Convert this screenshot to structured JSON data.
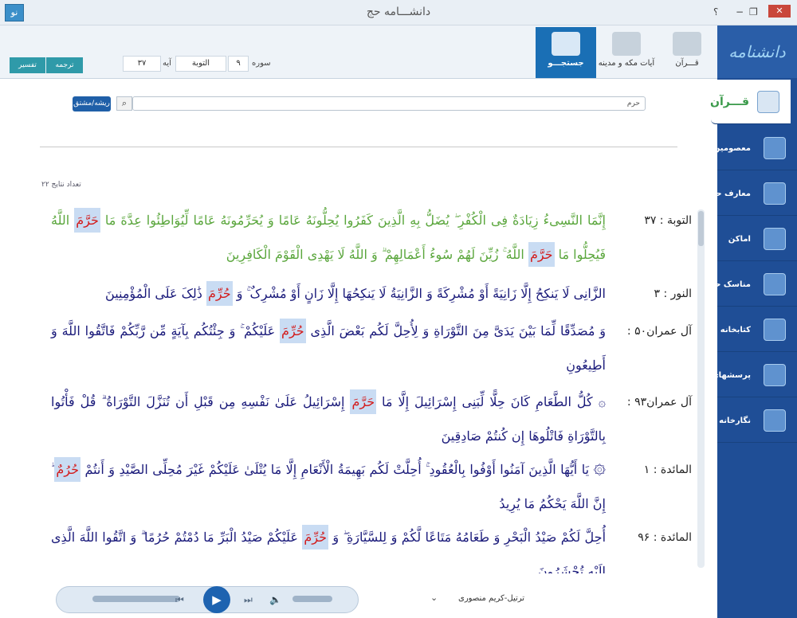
{
  "window": {
    "title": "دانشـــامه حج",
    "help": "؟",
    "restore": "❐",
    "minimize": "−",
    "close": "✕",
    "app_icon": "نو"
  },
  "sidebar": {
    "logo": "دانشنامه حج",
    "items": [
      {
        "label": "قـــرآن",
        "icon": "quran-stand-icon"
      },
      {
        "label": "معصومین",
        "icon": "shrine-icon"
      },
      {
        "label": "معارف حج",
        "icon": "book-icon"
      },
      {
        "label": "اماکن",
        "icon": "mosque-icon"
      },
      {
        "label": "مناسک حج",
        "icon": "pilgrim-icon"
      },
      {
        "label": "کتابخانه",
        "icon": "library-icon"
      },
      {
        "label": "پرسشهای رایج",
        "icon": "faq-icon"
      },
      {
        "label": "نگارخانه",
        "icon": "gallery-icon"
      }
    ]
  },
  "toolbar": {
    "tabs": [
      {
        "label": "قـــرآن"
      },
      {
        "label": "آیات مکه و مدینه"
      },
      {
        "label": "جستجـــو"
      }
    ],
    "surah_label": "سوره",
    "surah_number": "۹",
    "surah_name": "التوبة",
    "ayah_label": "آیه",
    "ayah_number": "۳۷",
    "translation_button": "ترجمه",
    "tafsir_button": "تفسیر"
  },
  "search": {
    "query": "حرم",
    "root_button": "ریشه/مشتق",
    "search_icon": "⌕",
    "results_count": "تعداد نتایج ۲۲"
  },
  "results": [
    {
      "ref": "التوبة :   ۳۷",
      "before": "إِنَّمَا النَّسِیءُ زِیَادَةٌ فِی الْکُفْرِ ۖ یُضَلُّ بِهِ الَّذِینَ کَفَرُوا یُحِلُّونَهُ عَامًا وَ یُحَرِّمُونَهُ عَامًا لِّیُوَاطِئُوا عِدَّةَ مَا ",
      "hl": "حَرَّمَ",
      "middle": " اللَّهُ فَیُحِلُّوا مَا ",
      "hl2": "حَرَّمَ",
      "after": " اللَّهُ ۚ زُیِّنَ لَهُمْ سُوءُ أَعْمَالِهِمْ ۗ وَ اللَّهُ لَا یَهْدِی الْقَوْمَ الْکَافِرِینَ"
    },
    {
      "ref": "النور :   ۳",
      "before": "الزَّانِی لَا یَنکِحُ إِلَّا زَانِیَةً أَوْ مُشْرِکَةً وَ الزَّانِیَةُ لَا یَنکِحُهَا إِلَّا زَانٍ أَوْ مُشْرِکٌ ۚ وَ ",
      "hl": "حُرِّمَ",
      "after": " ذَٰلِکَ عَلَى الْمُؤْمِنِینَ"
    },
    {
      "ref": "آل عمران۵۰ :",
      "before": "وَ مُصَدِّقًا لِّمَا بَیْنَ یَدَیَّ مِنَ التَّوْرَاةِ وَ لِأُحِلَّ لَکُم بَعْضَ الَّذِی ",
      "hl": "حُرِّمَ",
      "after": " عَلَیْکُمْ ۚ وَ جِئْتُکُم بِآیَةٍ مِّن رَّبِّکُمْ فَاتَّقُوا اللَّهَ وَ أَطِیعُونِ"
    },
    {
      "ref": "آل عمران۹۳ :",
      "before": "۞ کُلُّ الطَّعَامِ کَانَ حِلًّا لِّبَنِی إِسْرَائِیلَ إِلَّا مَا ",
      "hl": "حَرَّمَ",
      "after": " إِسْرَائِیلُ عَلَىٰ نَفْسِهِ مِن قَبْلِ أَن تُنَزَّلَ التَّوْرَاةُ ۗ قُلْ فَأْتُوا بِالتَّوْرَاةِ فَاتْلُوهَا إِن کُنتُمْ صَادِقِینَ"
    },
    {
      "ref": "المائدة :   ۱",
      "before": "۞ یَا أَیُّهَا الَّذِینَ آمَنُوا أَوْفُوا بِالْعُقُودِ ۚ أُحِلَّتْ لَکُم بَهِیمَةُ الْأَنْعَامِ إِلَّا مَا یُتْلَىٰ عَلَیْکُمْ غَیْرَ مُحِلِّی الصَّیْدِ وَ أَنتُمْ ",
      "hl": "حُرُمٌ",
      "after": " ۗ إِنَّ اللَّهَ یَحْکُمُ مَا یُرِیدُ"
    },
    {
      "ref": "المائدة :   ۹۶",
      "before": "أُحِلَّ لَکُمْ صَیْدُ الْبَحْرِ وَ طَعَامُهُ مَتَاعًا لَّکُمْ وَ لِلسَّیَّارَةِ ۖ وَ ",
      "hl": "حُرِّمَ",
      "after": " عَلَیْکُمْ صَیْدُ الْبَرِّ مَا دُمْتُمْ حُرُمًا ۗ وَ اتَّقُوا اللَّهَ الَّذِی إِلَیْهِ تُحْشَرُونَ"
    }
  ],
  "player": {
    "prev": "⏮",
    "play": "▶",
    "next": "⏭",
    "volume": "🔈",
    "reciter": "ترتیل-کریم منصوری",
    "chevron": "⌄"
  },
  "colors": {
    "sidebar": "#1f4e96",
    "accent": "#1a6fb5",
    "highlight_bg": "#c9dcf3",
    "highlight_text": "#d31b1b",
    "first_verse": "#5aa63c"
  }
}
